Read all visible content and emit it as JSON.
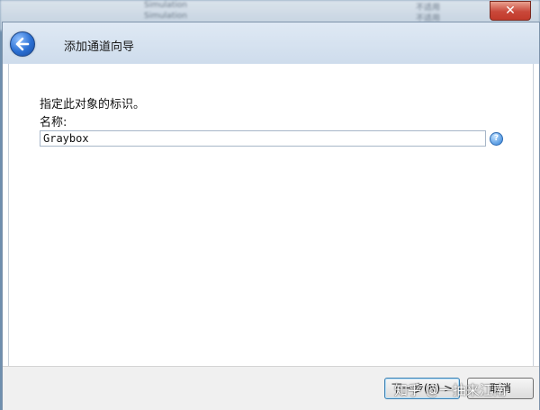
{
  "background_window": {
    "rows": [
      {
        "col1": "",
        "col2": "Simulation",
        "col3": "",
        "col4": "不适用"
      },
      {
        "col1": "",
        "col2": "Simulation",
        "col3": "",
        "col4": "不适用"
      }
    ]
  },
  "window": {
    "close_glyph": "✕"
  },
  "header": {
    "title": "添加通道向导",
    "back_icon": "back-arrow-icon"
  },
  "content": {
    "instruction": "指定此对象的标识。",
    "name_label": "名称:",
    "name_value": "Graybox",
    "help_glyph": "?"
  },
  "footer": {
    "next_label": "下一步(N) >",
    "cancel_label": "取消"
  },
  "watermark": "知乎 @一抽来江南",
  "colors": {
    "header_bg": "#d6e3f1",
    "accent": "#2a6fd3",
    "close": "#c9483a"
  }
}
